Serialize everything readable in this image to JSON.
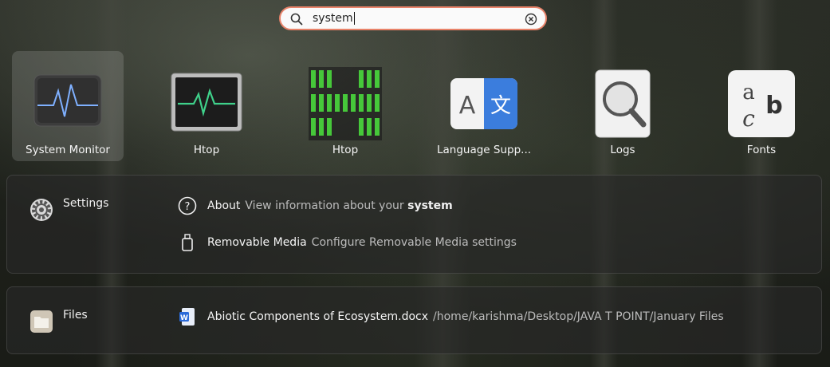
{
  "search": {
    "query": "system"
  },
  "apps": [
    {
      "name": "System Monitor",
      "icon": "system-monitor-icon",
      "selected": true
    },
    {
      "name": "Htop",
      "icon": "htop-terminal-icon"
    },
    {
      "name": "Htop",
      "icon": "htop-green-bars-icon"
    },
    {
      "name": "Language Supp...",
      "icon": "language-support-icon"
    },
    {
      "name": "Logs",
      "icon": "logs-magnifier-icon"
    },
    {
      "name": "Fonts",
      "icon": "fonts-icon"
    }
  ],
  "settings": {
    "provider": "Settings",
    "results": [
      {
        "title": "About",
        "desc_prefix": "View information about your ",
        "desc_match": "system",
        "icon": "help-circle-icon"
      },
      {
        "title": "Removable Media",
        "desc": "Configure Removable Media settings",
        "icon": "usb-drive-icon"
      }
    ]
  },
  "files": {
    "provider": "Files",
    "results": [
      {
        "title": "Abiotic Components of Ecosystem.docx",
        "path": "/home/karishma/Desktop/JAVA T POINT/January Files",
        "icon": "word-document-icon"
      }
    ]
  },
  "colors": {
    "search_border": "#e9836a",
    "accent_green": "#3fd08a",
    "translate_blue": "#3b7ddd"
  }
}
